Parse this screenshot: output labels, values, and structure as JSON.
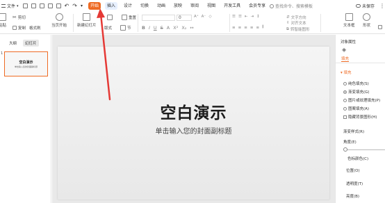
{
  "menubar": {
    "file_label": "文件",
    "tabs": [
      {
        "label": "开始",
        "active": true
      },
      {
        "label": "插入",
        "hl": true
      },
      {
        "label": "设计"
      },
      {
        "label": "切换"
      },
      {
        "label": "动画"
      },
      {
        "label": "放映"
      },
      {
        "label": "审阅"
      },
      {
        "label": "视图"
      },
      {
        "label": "开发工具"
      },
      {
        "label": "会员专享"
      }
    ],
    "search_placeholder": "查找命令、搜索模板",
    "unsaved_label": "未保存"
  },
  "ribbon": {
    "cut_label": "剪切",
    "paste_label": "粘贴",
    "copy_label": "复制",
    "format_painter_label": "格式刷",
    "play_from_current_label": "当页开始",
    "new_slide_label": "新建幻灯片",
    "layout_label": "版式",
    "section_label": "节",
    "reset_label": "重置",
    "font_size_value": "0",
    "text_direction_label": "文字方向",
    "align_text_label": "对齐文本",
    "convert_smartart_label": "转智能图形",
    "textbox_label": "文本框",
    "shape_label": "形状"
  },
  "left_panel": {
    "tabs": [
      {
        "label": "大纲"
      },
      {
        "label": "幻灯片",
        "active": true
      }
    ],
    "thumbnail": {
      "number": "1",
      "title": "空白演示",
      "subtitle": "单击输入您的封面副标题"
    }
  },
  "slide": {
    "title": "空白演示",
    "subtitle": "单击输入您的封面副标题"
  },
  "right_panel": {
    "header": "对象属性",
    "tab_fill": "填充",
    "section_fill": "填充",
    "fill_options": [
      {
        "label": "纯色填充(S)",
        "checked": false
      },
      {
        "label": "渐变填充(G)",
        "checked": true
      },
      {
        "label": "图片或纹理填充(P)",
        "checked": false
      },
      {
        "label": "图案填充(A)",
        "checked": false
      }
    ],
    "hide_bg_label": "隐藏背景图形(H)",
    "gradient_style_label": "渐变样式(R)",
    "angle_label": "角度(E)",
    "color_label": "色标颜色(C)",
    "position_label": "位置(O)",
    "transparency_label": "透明度(T)",
    "brightness_label": "亮度(B)"
  },
  "colors": {
    "accent": "#ee6a23",
    "arrow": "#e53935"
  }
}
